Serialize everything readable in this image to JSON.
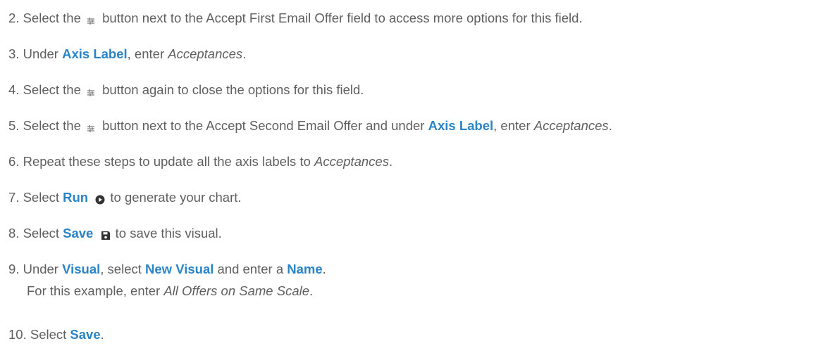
{
  "icons": {
    "tune": "tune-icon",
    "play": "play-circle-icon",
    "save": "floppy-disk-icon"
  },
  "colors": {
    "text": "#5f5f5f",
    "ui_accent": "#2a84c6"
  },
  "steps": [
    {
      "num": "2.",
      "before": "Select the",
      "after": "button next to the Accept First Email Offer field to access more options for this field."
    },
    {
      "num": "3.",
      "t1": "Under",
      "ui": "Axis Label",
      "t2": ", enter",
      "em": "Acceptances",
      "t3": "."
    },
    {
      "num": "4.",
      "before": "Select the",
      "after": "button again to close the options for this field."
    },
    {
      "num": "5.",
      "before": "Select the",
      "t1": "button next to the Accept Second Email Offer and under",
      "ui": "Axis Label",
      "t2": ", enter",
      "em": "Acceptances",
      "t3": "."
    },
    {
      "num": "6.",
      "t1": "Repeat these steps to update all the axis labels to",
      "em": "Acceptances",
      "t2": "."
    },
    {
      "num": "7.",
      "t1": "Select",
      "ui": "Run",
      "t2": "to generate your chart."
    },
    {
      "num": "8.",
      "t1": "Select",
      "ui": "Save",
      "t2": "to save this visual."
    },
    {
      "num": "9.",
      "t1": "Under",
      "ui1": "Visual",
      "t2": ", select",
      "ui2": "New Visual",
      "t3": "and enter a",
      "ui3": "Name",
      "t4": ".",
      "line2": "For this example, enter",
      "line2_em": "All Offers on Same Scale",
      "line2_end": "."
    },
    {
      "num": "10.",
      "t1": "Select",
      "ui": "Save",
      "t2": "."
    }
  ]
}
